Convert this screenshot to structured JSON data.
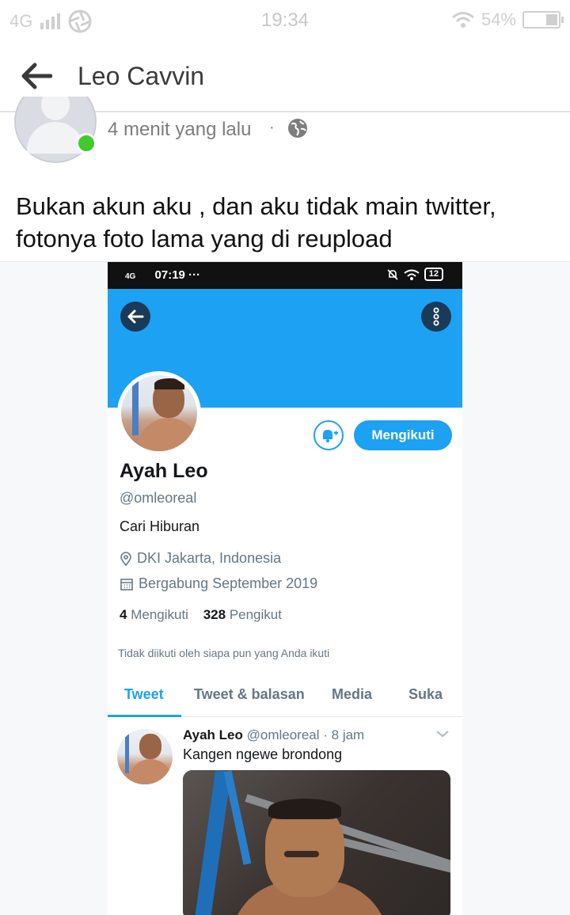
{
  "status_bar": {
    "network": "4G",
    "time": "19:34",
    "battery": "54%"
  },
  "header": {
    "title": "Leo Cavvin"
  },
  "post": {
    "timestamp": "4 menit yang lalu",
    "separator": "·",
    "text": "Bukan akun aku , dan aku tidak main twitter, fotonya foto lama yang di reupload"
  },
  "screenshot": {
    "status_bar": {
      "network": "4G",
      "time": "07:19 ···",
      "battery": "12"
    },
    "profile": {
      "name": "Ayah Leo",
      "handle": "@omleoreal",
      "bio": "Cari Hiburan",
      "location": "DKI Jakarta, Indonesia",
      "joined": "Bergabung September 2019",
      "following_count": "4",
      "following_label": "Mengikuti",
      "followers_count": "328",
      "followers_label": "Pengikut",
      "follow_button": "Mengikuti",
      "not_followed_note": "Tidak diikuti oleh siapa pun yang Anda ikuti"
    },
    "tabs": [
      "Tweet",
      "Tweet & balasan",
      "Media",
      "Suka"
    ],
    "tweet": {
      "name": "Ayah Leo",
      "meta": "@omleoreal · 8 jam",
      "text": "Kangen ngewe brondong"
    },
    "colors": {
      "twitter_blue": "#1da1f2",
      "dark_button": "#1a3a5a"
    }
  },
  "colors": {
    "online_green": "#42c92c",
    "text_dark": "#111111",
    "text_muted": "#7d7d7d"
  }
}
